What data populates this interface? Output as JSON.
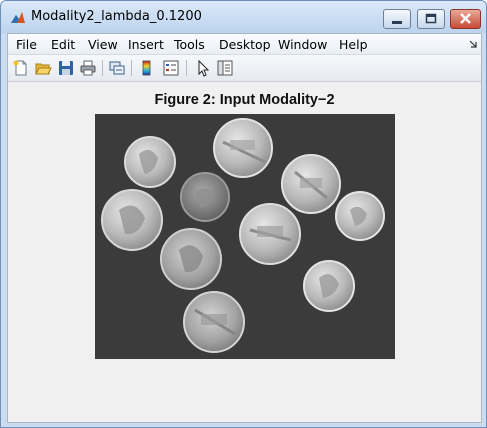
{
  "window": {
    "title": "Modality2_lambda_0.1200",
    "controls": [
      "minimize-icon",
      "maximize-icon",
      "close-icon"
    ]
  },
  "menubar": {
    "items": [
      {
        "label": "File"
      },
      {
        "label": "Edit"
      },
      {
        "label": "View"
      },
      {
        "label": "Insert"
      },
      {
        "label": "Tools"
      },
      {
        "label": "Desktop"
      },
      {
        "label": "Window"
      },
      {
        "label": "Help"
      }
    ]
  },
  "toolbar": {
    "buttons": [
      {
        "icon": "new-figure-icon"
      },
      {
        "icon": "open-file-icon"
      },
      {
        "icon": "save-icon"
      },
      {
        "icon": "print-icon"
      },
      {
        "icon": "link-figure-icon"
      },
      {
        "icon": "colorbar-icon"
      },
      {
        "icon": "legend-icon"
      },
      {
        "icon": "pointer-icon"
      },
      {
        "icon": "property-editor-icon"
      }
    ]
  },
  "figure": {
    "title": "Figure 2: Input Modality−2",
    "image_description_icon": "coins-image"
  },
  "colors": {
    "titlebar": "#c9dcf1",
    "client": "#f0f0f0",
    "image_background": "#3a3a3a",
    "close_button": "#c94a36"
  }
}
